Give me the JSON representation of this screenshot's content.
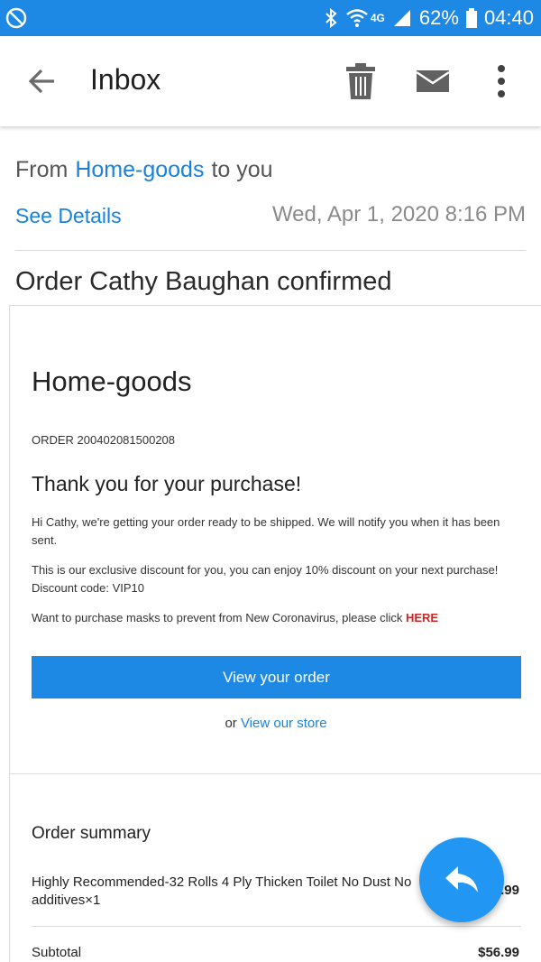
{
  "status_bar": {
    "network": "4G",
    "battery_pct": "62%",
    "time": "04:40",
    "icons": [
      "do-not-disturb-icon",
      "bluetooth-icon",
      "wifi-icon",
      "signal-icon",
      "battery-icon"
    ]
  },
  "app_bar": {
    "title": "Inbox",
    "icons": [
      "back-arrow-icon",
      "trash-icon",
      "mail-icon",
      "more-vert-icon"
    ]
  },
  "header": {
    "from_label": "From",
    "sender": "Home-goods",
    "to_label": "to you",
    "see_details": "See Details",
    "date": "Wed, Apr 1, 2020 8:16 PM"
  },
  "subject": "Order Cathy Baughan confirmed",
  "body": {
    "store_name": "Home-goods",
    "order_number": "ORDER 200402081500208",
    "thanks": "Thank you for your purchase!",
    "paragraph1": "Hi Cathy, we're getting your order ready to be shipped. We will notify you when it has been sent.",
    "paragraph2": "This is our exclusive discount for you, you can enjoy 10% discount on your next purchase! Discount code: VIP10",
    "paragraph3_text": "Want to purchase masks to prevent from New Coronavirus, please click ",
    "paragraph3_link": "HERE",
    "view_order_button": "View your order",
    "or_text": "or",
    "view_store_link": "View our store"
  },
  "order_summary": {
    "title": "Order summary",
    "items": [
      {
        "name": "Highly Recommended-32 Rolls 4 Ply Thicken Toilet No Dust No additives×1",
        "price": "$56.99"
      }
    ],
    "subtotal_label": "Subtotal",
    "subtotal_value": "$56.99"
  },
  "colors": {
    "primary": "#1e88e5",
    "link": "#1a82d8",
    "fab": "#2196f3",
    "link_red": "#c62828"
  }
}
